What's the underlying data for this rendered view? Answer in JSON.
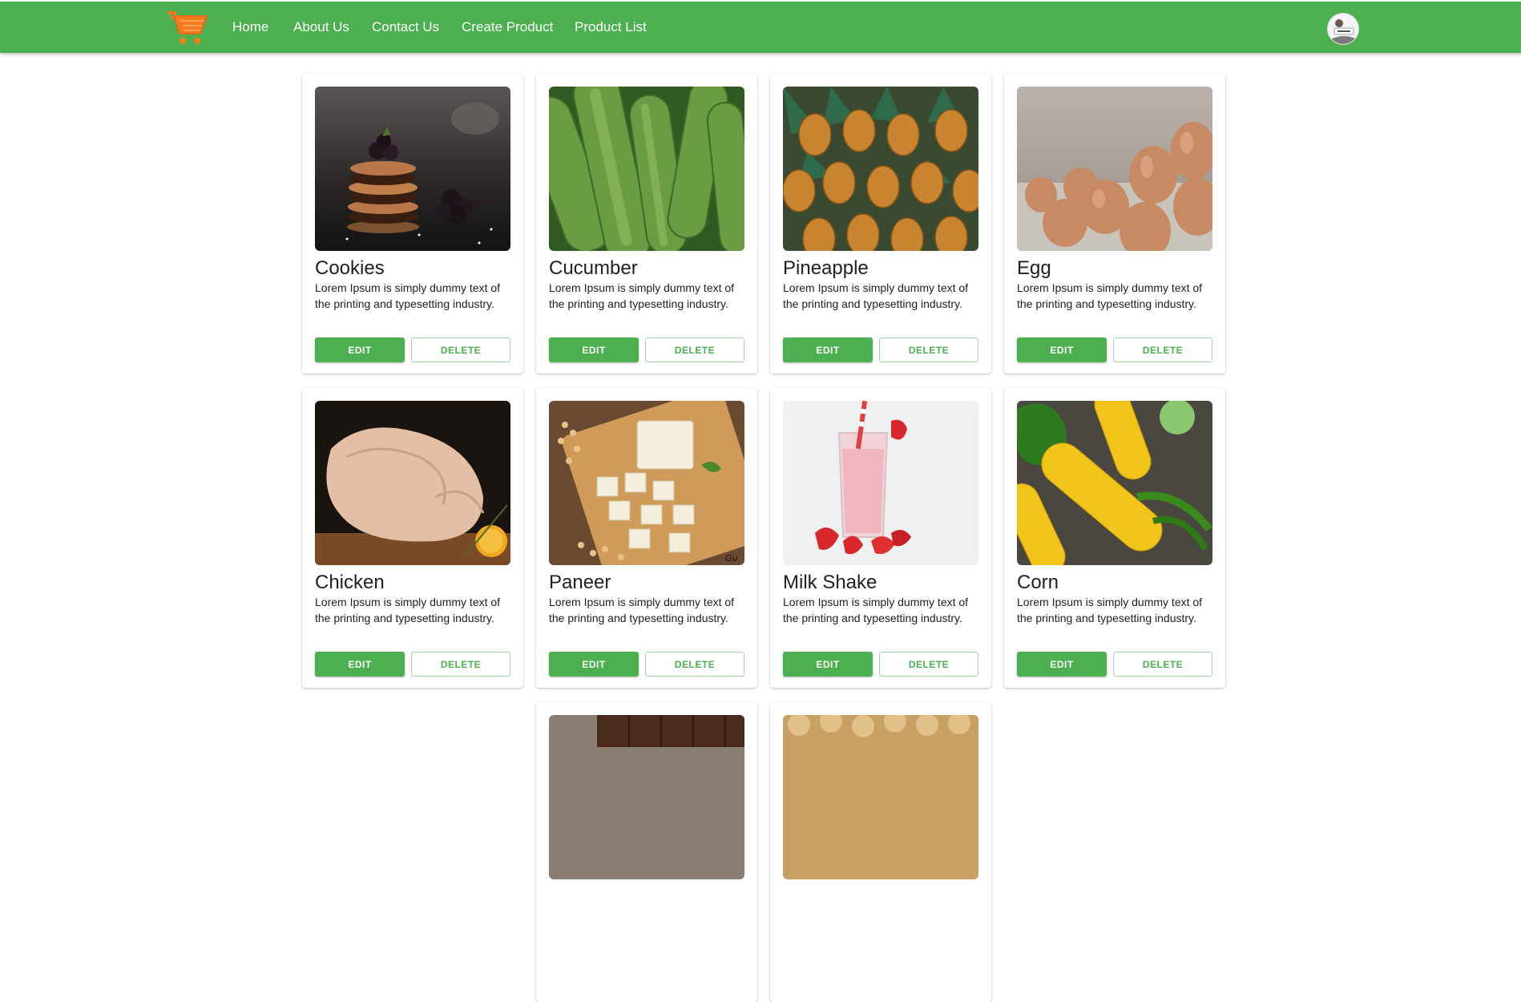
{
  "nav": {
    "logo_icon": "shopping-cart-logo-icon",
    "links": [
      "Home",
      "About Us",
      "Contact Us",
      "Create Product",
      "Product List"
    ],
    "avatar_icon": "user-avatar-icon"
  },
  "colors": {
    "primary": "#4caf50",
    "logo": "#f57c1f",
    "text": "#212121"
  },
  "products": [
    {
      "name": "Cookies",
      "description": "Lorem Ipsum is simply dummy text of the printing and typesetting industry.",
      "edit_label": "EDIT",
      "delete_label": "DELETE",
      "image_icon": "cookies-photo"
    },
    {
      "name": "Cucumber",
      "description": "Lorem Ipsum is simply dummy text of the printing and typesetting industry.",
      "edit_label": "EDIT",
      "delete_label": "DELETE",
      "image_icon": "cucumber-photo"
    },
    {
      "name": "Pineapple",
      "description": "Lorem Ipsum is simply dummy text of the printing and typesetting industry.",
      "edit_label": "EDIT",
      "delete_label": "DELETE",
      "image_icon": "pineapple-photo"
    },
    {
      "name": "Egg",
      "description": "Lorem Ipsum is simply dummy text of the printing and typesetting industry.",
      "edit_label": "EDIT",
      "delete_label": "DELETE",
      "image_icon": "egg-photo"
    },
    {
      "name": "Chicken",
      "description": "Lorem Ipsum is simply dummy text of the printing and typesetting industry.",
      "edit_label": "EDIT",
      "delete_label": "DELETE",
      "image_icon": "chicken-photo"
    },
    {
      "name": "Paneer",
      "description": "Lorem Ipsum is simply dummy text of the printing and typesetting industry.",
      "edit_label": "EDIT",
      "delete_label": "DELETE",
      "image_icon": "paneer-photo"
    },
    {
      "name": "Milk Shake",
      "description": "Lorem Ipsum is simply dummy text of the printing and typesetting industry.",
      "edit_label": "EDIT",
      "delete_label": "DELETE",
      "image_icon": "milkshake-photo"
    },
    {
      "name": "Corn",
      "description": "Lorem Ipsum is simply dummy text of the printing and typesetting industry.",
      "edit_label": "EDIT",
      "delete_label": "DELETE",
      "image_icon": "corn-photo"
    }
  ],
  "partial_products": [
    {
      "image_icon": "chocolate-photo"
    },
    {
      "image_icon": "snacks-photo"
    }
  ]
}
